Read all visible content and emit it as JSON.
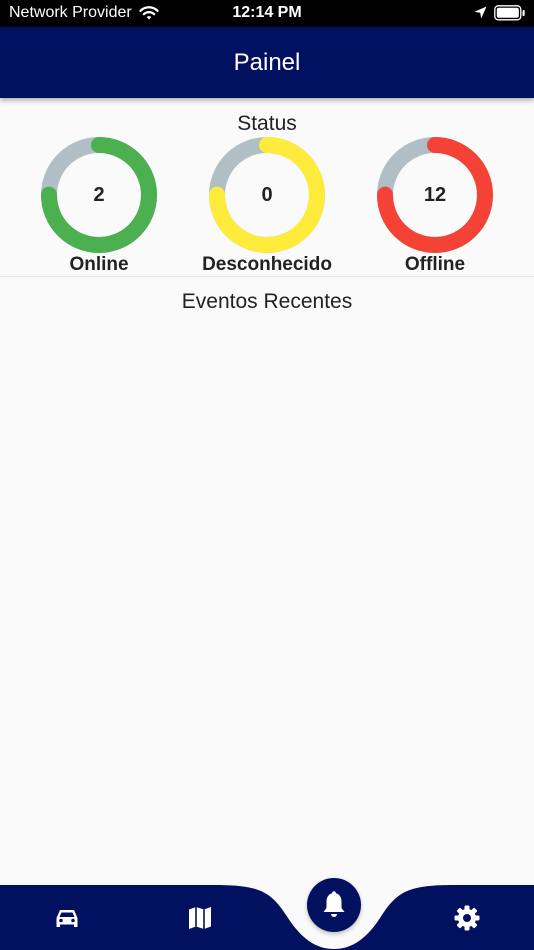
{
  "status_bar": {
    "carrier": "Network Provider",
    "time": "12:14 PM",
    "wifi_icon": "wifi-icon",
    "location_icon": "location-arrow-icon",
    "battery_icon": "battery-icon"
  },
  "app_bar": {
    "title": "Painel"
  },
  "status_section": {
    "title": "Status",
    "gauges": [
      {
        "label": "Online",
        "count": "2",
        "fraction": 0.75,
        "color": "#4caf50"
      },
      {
        "label": "Desconhecido",
        "count": "0",
        "fraction": 0.75,
        "color": "#ffeb3b"
      },
      {
        "label": "Offline",
        "count": "12",
        "fraction": 0.75,
        "color": "#f44336"
      }
    ],
    "track_color": "#b0bec5"
  },
  "events_section": {
    "title": "Eventos Recentes"
  },
  "bottom_nav": {
    "background": "#021060",
    "items": [
      {
        "icon": "car-icon"
      },
      {
        "icon": "map-icon"
      },
      {
        "icon": "bell-icon",
        "active": true
      },
      {
        "icon": "gear-icon"
      }
    ]
  }
}
